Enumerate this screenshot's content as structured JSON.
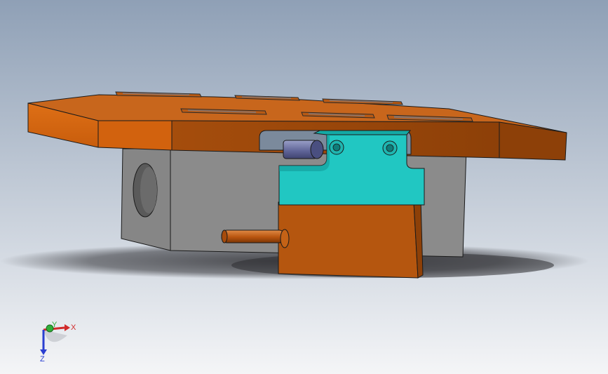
{
  "viewport": {
    "background_top": "#8fa0b6",
    "background_bottom": "#f4f5f7"
  },
  "colors": {
    "copper": "#d2620e",
    "copper_dark": "#a34a0a",
    "copper_top": "#c8661c",
    "steel": "#8c8c8c",
    "steel_dark": "#6f6f6f",
    "teal": "#21c7c2",
    "teal_dark": "#139a97",
    "slate_pin": "#6a6fa0",
    "shadow": "#2e2e32",
    "edge": "#1a1a1a"
  },
  "parts": [
    {
      "name": "top-plate",
      "icon": "copper-plate-with-slots"
    },
    {
      "name": "base-block",
      "icon": "gray-block-with-hole"
    },
    {
      "name": "clamp-head",
      "icon": "teal-bracket-with-bolts"
    },
    {
      "name": "slider-block",
      "icon": "copper-block"
    },
    {
      "name": "guide-pin",
      "icon": "slate-cylinder-pin"
    },
    {
      "name": "ejector-pin",
      "icon": "copper-rod"
    }
  ],
  "triad": {
    "x_label": "X",
    "y_label": "Y",
    "z_label": "Z",
    "x_color": "#d12b2b",
    "y_color": "#2fae37",
    "z_color": "#2a3fd1"
  }
}
